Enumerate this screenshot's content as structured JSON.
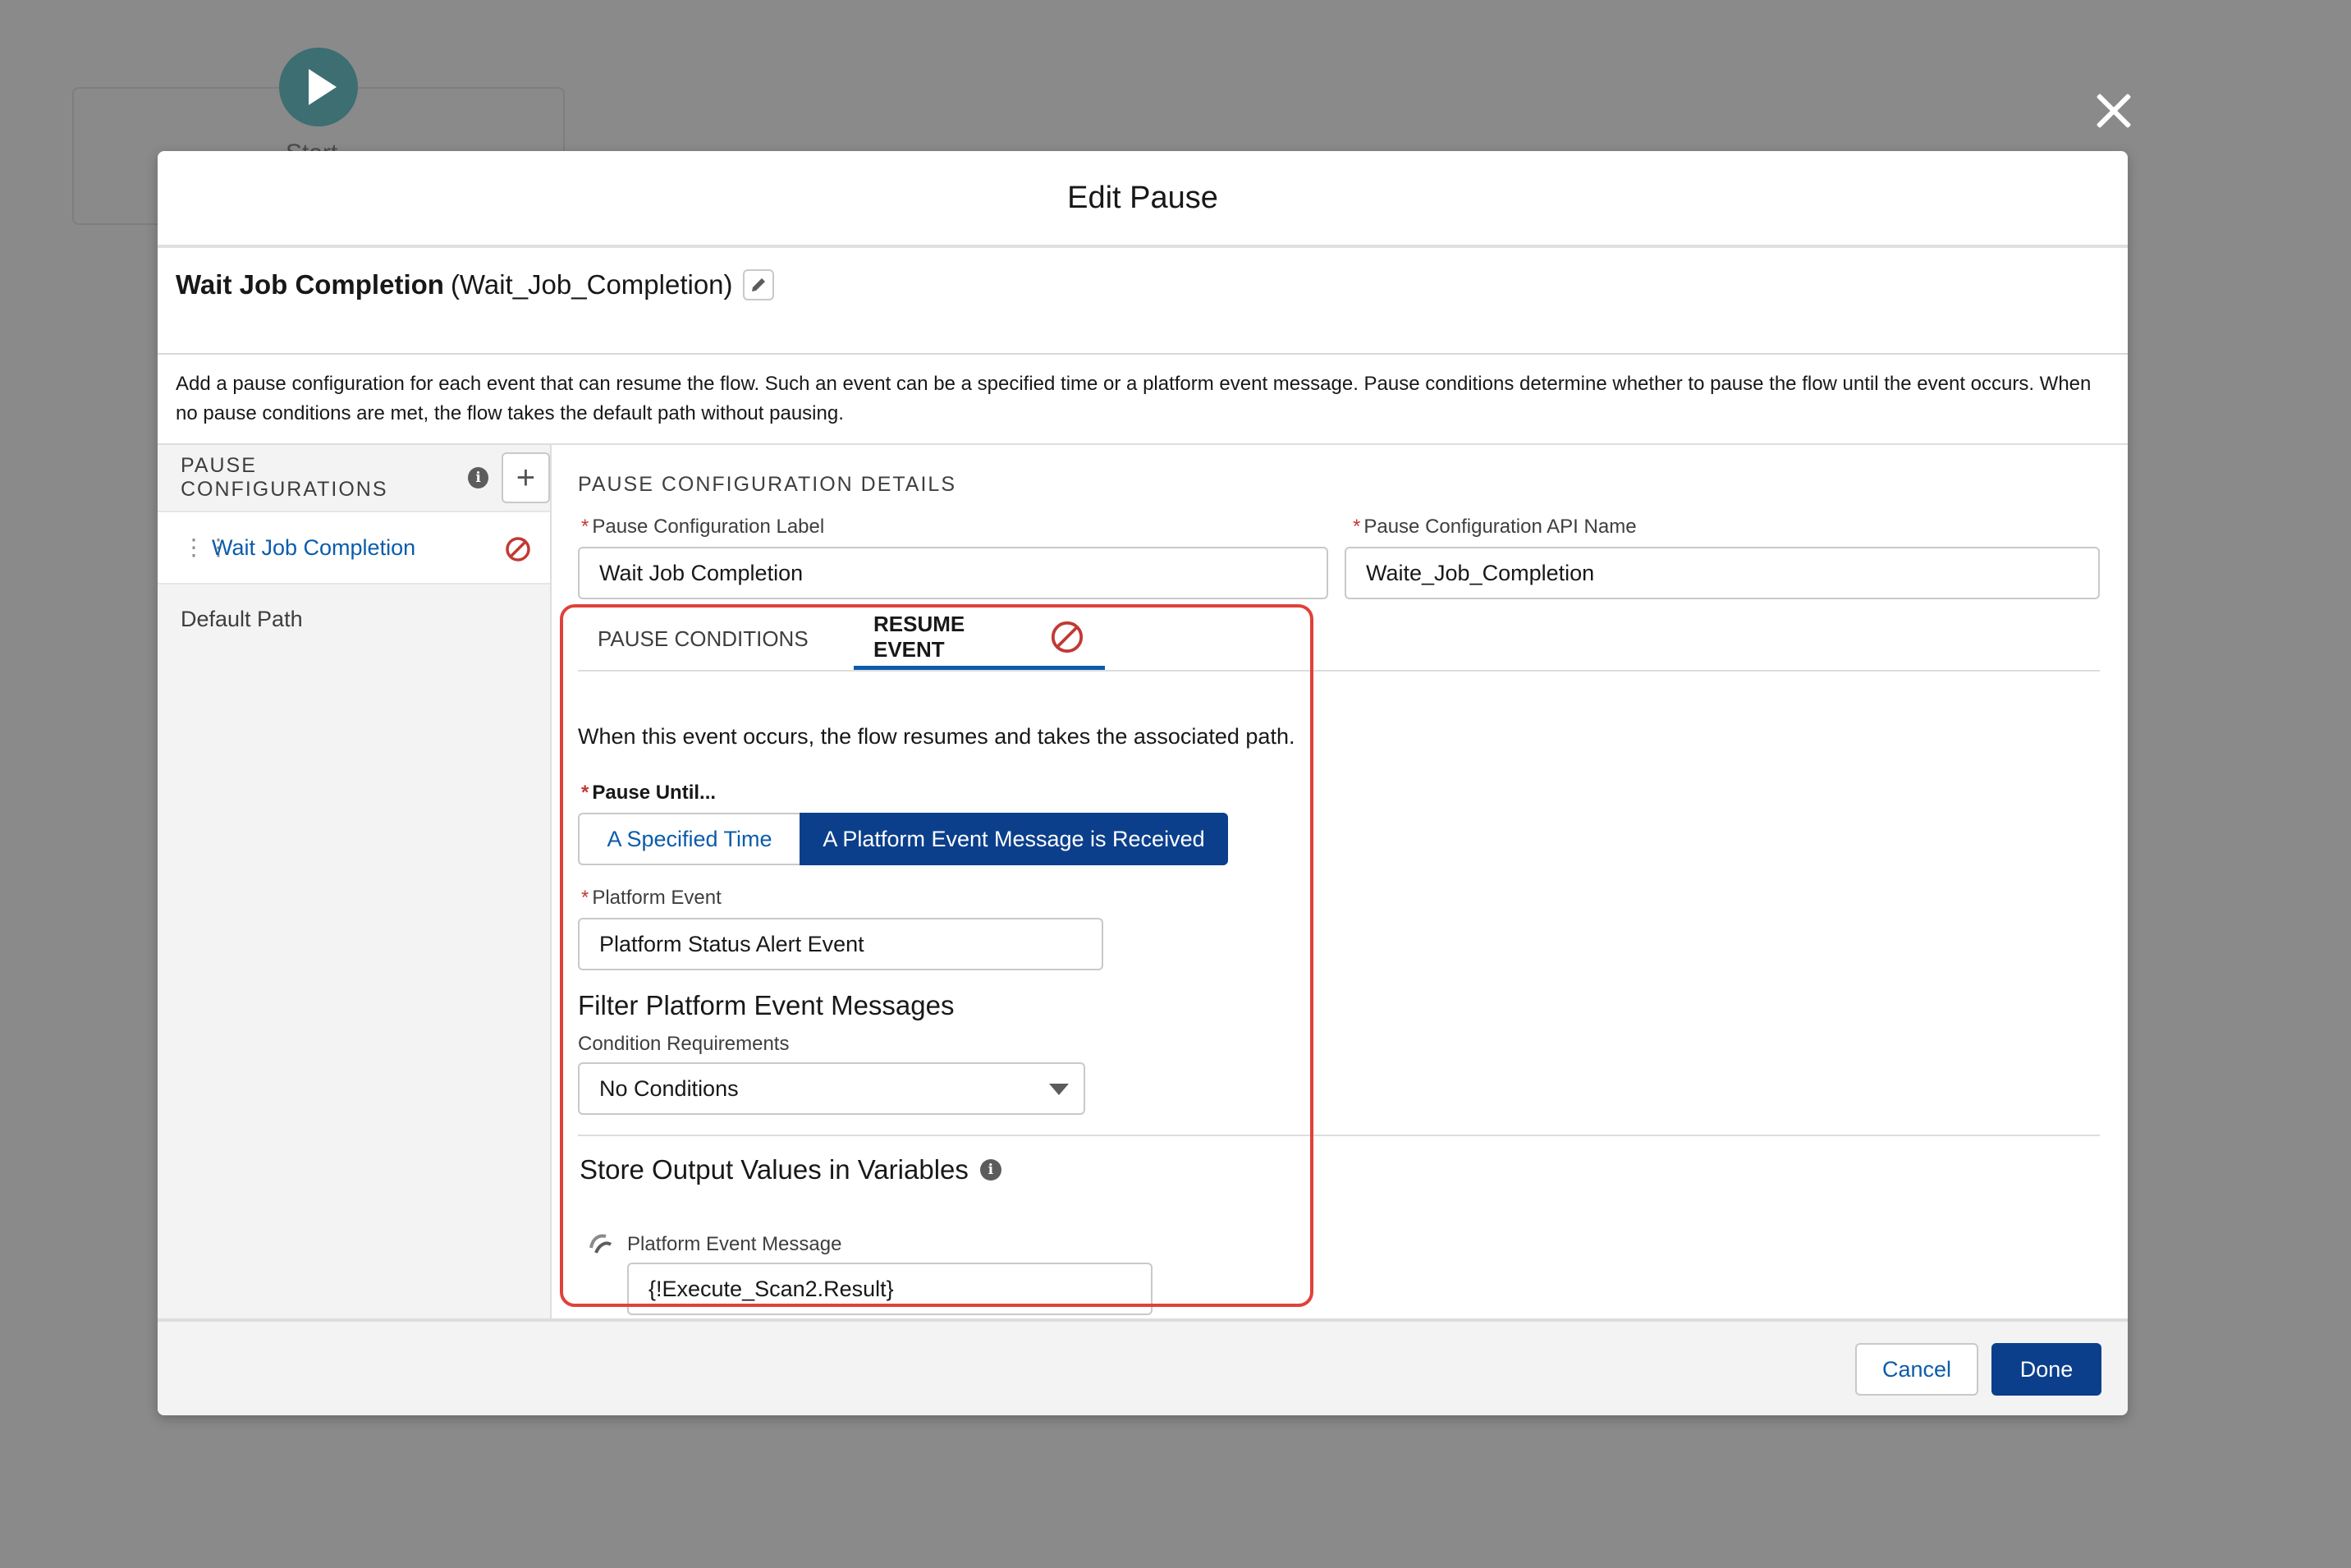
{
  "canvas": {
    "start_label": "Start"
  },
  "modal": {
    "title": "Edit Pause",
    "element_label": "Wait Job Completion",
    "element_api_name": "(Wait_Job_Completion)",
    "description": "Add a pause configuration for each event that can resume the flow. Such an event can be a specified time or a platform event message. Pause conditions determine whether to pause the flow until the event occurs. When no pause conditions are met, the flow takes the default path without pausing."
  },
  "sidebar": {
    "heading": "PAUSE CONFIGURATIONS",
    "items": [
      {
        "label": "Wait Job Completion",
        "has_error": true
      },
      {
        "label": "Default Path"
      }
    ]
  },
  "details": {
    "heading": "PAUSE CONFIGURATION DETAILS",
    "label_field": {
      "label": "Pause Configuration Label",
      "value": "Wait Job Completion"
    },
    "api_field": {
      "label": "Pause Configuration API Name",
      "value": "Waite_Job_Completion"
    },
    "tabs": [
      {
        "label": "PAUSE CONDITIONS",
        "active": false
      },
      {
        "label": "RESUME EVENT",
        "active": true,
        "has_error": true
      }
    ],
    "resume_description": "When this event occurs, the flow resumes and takes the associated path.",
    "pause_until": {
      "label": "Pause Until...",
      "options": [
        "A Specified Time",
        "A Platform Event Message is Received"
      ],
      "selected": "A Platform Event Message is Received"
    },
    "platform_event": {
      "label": "Platform Event",
      "value": "Platform Status Alert Event"
    },
    "filter": {
      "heading": "Filter Platform Event Messages",
      "condition_label": "Condition Requirements",
      "condition_value": "No Conditions"
    },
    "output": {
      "heading": "Store Output Values in Variables",
      "field_label": "Platform Event Message",
      "field_value": "{!Execute_Scan2.Result}"
    }
  },
  "footer": {
    "cancel_label": "Cancel",
    "done_label": "Done"
  },
  "colors": {
    "accent": "#0b5cab",
    "brand_dark": "#0b3f8c",
    "error": "#c23934",
    "highlight": "#e0413a"
  }
}
